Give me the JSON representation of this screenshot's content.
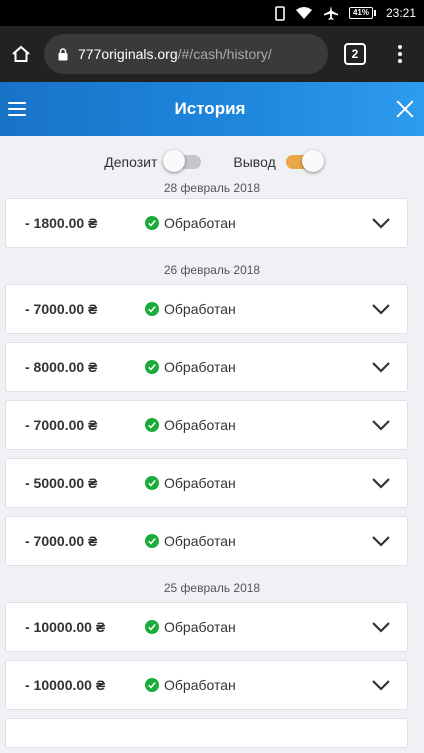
{
  "status_bar": {
    "battery": "41%",
    "time": "23:21"
  },
  "browser": {
    "url_host": "777originals.org",
    "url_path": "/#/cash/history/",
    "tab_count": "2"
  },
  "header": {
    "title": "История"
  },
  "toggles": {
    "deposit": {
      "label": "Депозит",
      "on": false
    },
    "withdraw": {
      "label": "Вывод",
      "on": true
    }
  },
  "groups": [
    {
      "date": "28 февраль 2018",
      "items": [
        {
          "amount": "- 1800.00 ₴",
          "status": "Обработан"
        }
      ]
    },
    {
      "date": "26 февраль 2018",
      "items": [
        {
          "amount": "- 7000.00 ₴",
          "status": "Обработан"
        },
        {
          "amount": "- 8000.00 ₴",
          "status": "Обработан"
        },
        {
          "amount": "- 7000.00 ₴",
          "status": "Обработан"
        },
        {
          "amount": "- 5000.00 ₴",
          "status": "Обработан"
        },
        {
          "amount": "- 7000.00 ₴",
          "status": "Обработан"
        }
      ]
    },
    {
      "date": "25 февраль 2018",
      "items": [
        {
          "amount": "- 10000.00 ₴",
          "status": "Обработан"
        },
        {
          "amount": "- 10000.00 ₴",
          "status": "Обработан"
        }
      ]
    }
  ],
  "colors": {
    "header_start": "#1873c8",
    "header_end": "#2e9cee",
    "toggle_on": "#e9a84a",
    "status_ok": "#1bab3a"
  }
}
